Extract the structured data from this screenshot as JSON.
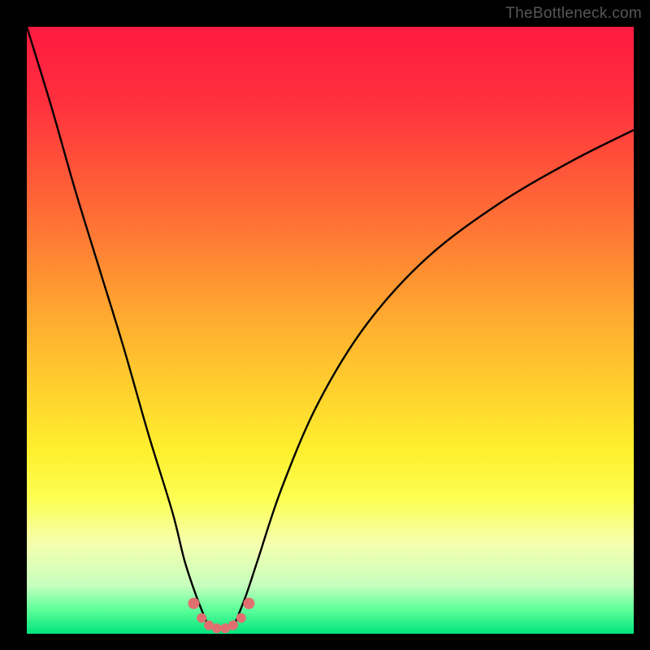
{
  "watermark": "TheBottleneck.com",
  "chart_data": {
    "type": "line",
    "title": "",
    "xlabel": "",
    "ylabel": "",
    "xlim": [
      0,
      100
    ],
    "ylim": [
      0,
      100
    ],
    "gradient_stops": [
      {
        "pos": 0.0,
        "color": "#ff1a41"
      },
      {
        "pos": 0.12,
        "color": "#ff2f3e"
      },
      {
        "pos": 0.3,
        "color": "#ff6a36"
      },
      {
        "pos": 0.5,
        "color": "#ffb22f"
      },
      {
        "pos": 0.7,
        "color": "#fff02e"
      },
      {
        "pos": 0.78,
        "color": "#fcff54"
      },
      {
        "pos": 0.85,
        "color": "#f6ffae"
      },
      {
        "pos": 0.92,
        "color": "#c7ffbe"
      },
      {
        "pos": 0.96,
        "color": "#5eff9a"
      },
      {
        "pos": 1.0,
        "color": "#00e47d"
      }
    ],
    "series": [
      {
        "name": "left-curve",
        "x": [
          0,
          4,
          8,
          12,
          16,
          20,
          24,
          26,
          28,
          30
        ],
        "y": [
          100,
          87,
          73,
          60,
          47,
          33,
          20,
          12,
          6,
          1
        ]
      },
      {
        "name": "right-curve",
        "x": [
          34,
          36,
          38,
          42,
          48,
          56,
          66,
          78,
          90,
          100
        ],
        "y": [
          1,
          6,
          12,
          24,
          38,
          51,
          62,
          71,
          78,
          83
        ]
      }
    ],
    "markers": {
      "name": "bottom-markers",
      "color": "#e07070",
      "points": [
        {
          "x": 27.5,
          "y": 5.0,
          "r": 7
        },
        {
          "x": 28.8,
          "y": 2.6,
          "r": 6
        },
        {
          "x": 30.0,
          "y": 1.4,
          "r": 6
        },
        {
          "x": 31.3,
          "y": 0.9,
          "r": 6
        },
        {
          "x": 32.7,
          "y": 0.9,
          "r": 6
        },
        {
          "x": 34.0,
          "y": 1.4,
          "r": 6
        },
        {
          "x": 35.3,
          "y": 2.6,
          "r": 6
        },
        {
          "x": 36.6,
          "y": 5.0,
          "r": 7
        }
      ]
    }
  }
}
